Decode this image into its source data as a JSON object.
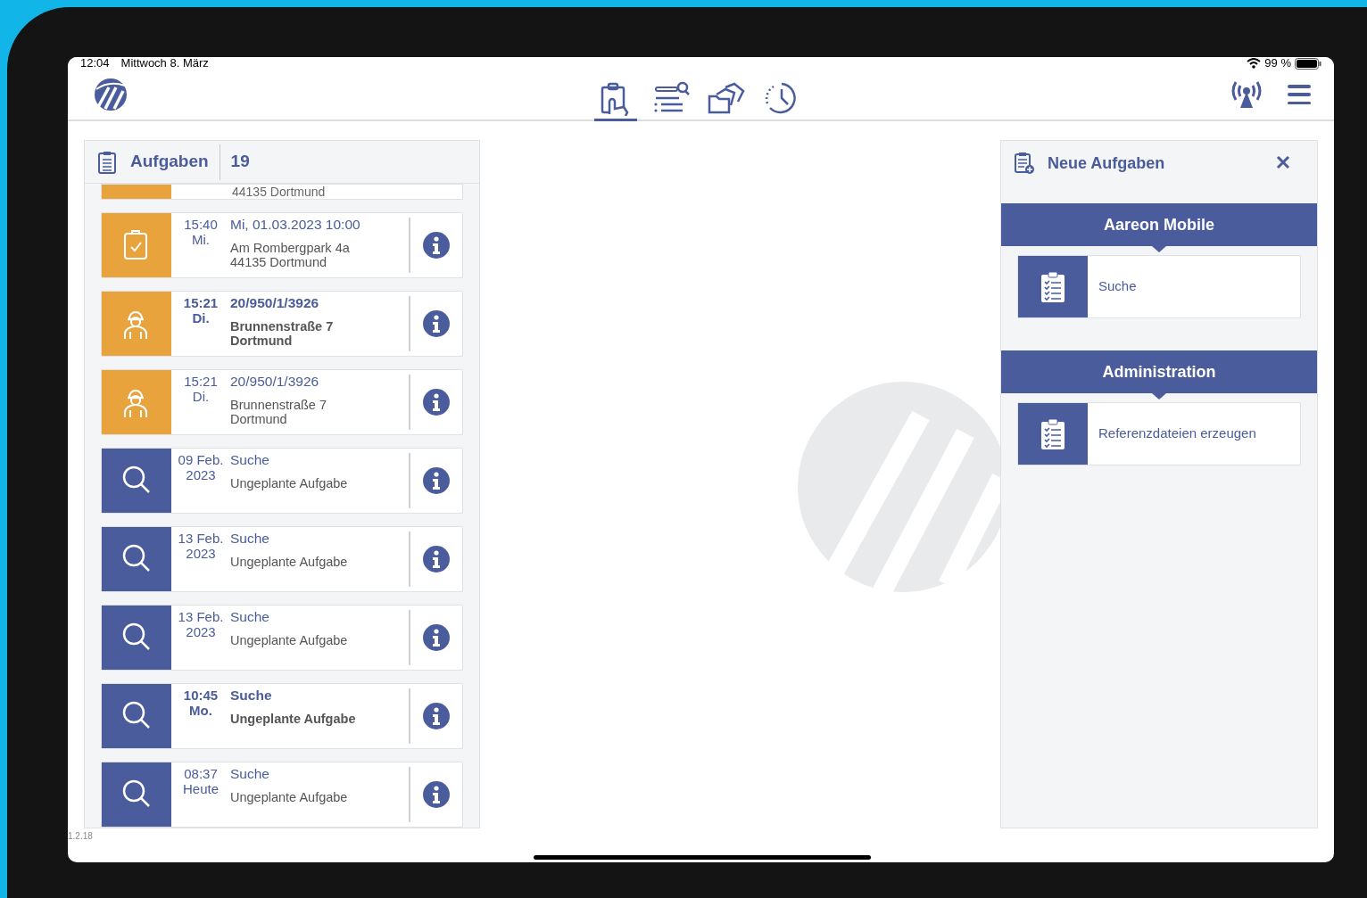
{
  "status_bar": {
    "time": "12:04",
    "date": "Mittwoch 8. März",
    "battery": "99 %"
  },
  "nav_tabs": [
    {
      "kind": "touch",
      "selected": true
    },
    {
      "kind": "list-search",
      "selected": false
    },
    {
      "kind": "folders",
      "selected": false
    },
    {
      "kind": "history",
      "selected": false
    }
  ],
  "tasks_panel": {
    "title": "Aufgaben",
    "count": "19",
    "partial_row": {
      "line": "44135 Dortmund",
      "kind": "task"
    },
    "rows": [
      {
        "kind": "task",
        "unread": false,
        "time": "15:40",
        "day": "Mi.",
        "title": "Mi, 01.03.2023 10:00",
        "line1": "Am Rombergpark 4a",
        "line2": "44135 Dortmund"
      },
      {
        "kind": "worker",
        "unread": true,
        "time": "15:21",
        "day": "Di.",
        "title": "20/950/1/3926",
        "line1": "Brunnenstraße 7",
        "line2": "Dortmund"
      },
      {
        "kind": "worker",
        "unread": false,
        "time": "15:21",
        "day": "Di.",
        "title": "20/950/1/3926",
        "line1": "Brunnenstraße 7",
        "line2": "Dortmund"
      },
      {
        "kind": "search",
        "unread": false,
        "time": "09 Feb.",
        "day": "2023",
        "title": "Suche",
        "line1": "Ungeplante Aufgabe"
      },
      {
        "kind": "search",
        "unread": false,
        "time": "13 Feb.",
        "day": "2023",
        "title": "Suche",
        "line1": "Ungeplante Aufgabe"
      },
      {
        "kind": "search",
        "unread": false,
        "time": "13 Feb.",
        "day": "2023",
        "title": "Suche",
        "line1": "Ungeplante Aufgabe"
      },
      {
        "kind": "search",
        "unread": true,
        "time": "10:45",
        "day": "Mo.",
        "title": "Suche",
        "line1": "Ungeplante Aufgabe"
      },
      {
        "kind": "search",
        "unread": false,
        "time": "08:37",
        "day": "Heute",
        "title": "Suche",
        "line1": "Ungeplante Aufgabe"
      }
    ]
  },
  "new_tasks_panel": {
    "title": "Neue Aufgaben",
    "sections": [
      {
        "title": "Aareon Mobile",
        "items": [
          {
            "label": "Suche"
          }
        ]
      },
      {
        "title": "Administration",
        "items": [
          {
            "label": "Referenzdateien erzeugen"
          }
        ]
      }
    ]
  },
  "version": "1.2.18"
}
